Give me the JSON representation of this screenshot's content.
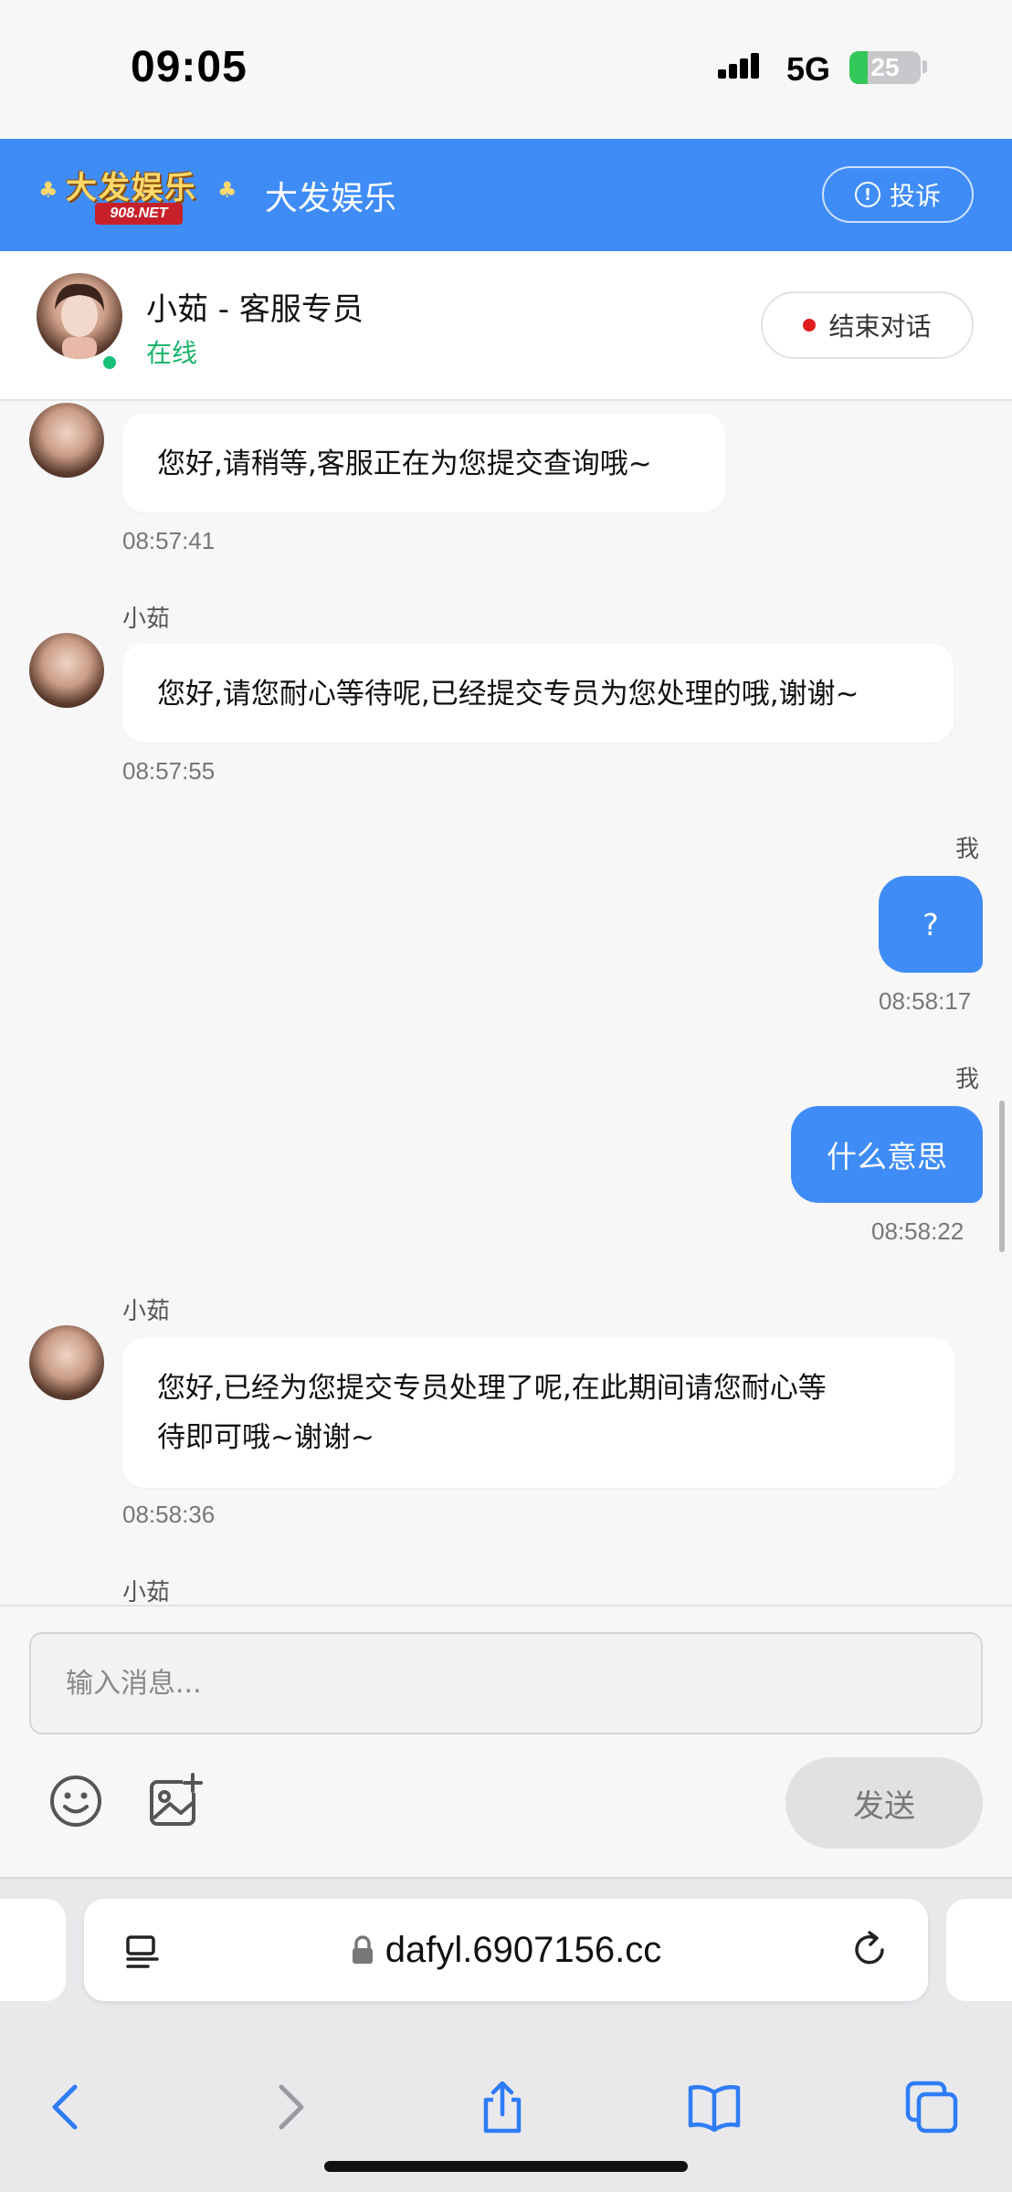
{
  "status_bar": {
    "time": "09:05",
    "network": "5G",
    "battery": "25",
    "battery_level": 0.25,
    "signal_icon": "cellular-signal-icon",
    "battery_icon": "battery-charging-icon"
  },
  "header": {
    "logo_text": "大发娱乐",
    "logo_sub": "908.NET",
    "title": "大发娱乐",
    "complain_label": "投诉",
    "complain_icon": "exclamation-circle-icon",
    "color": "#3f8cf7"
  },
  "agent": {
    "name": "小茹 - 客服专员",
    "status": "在线",
    "status_color": "#18b46c",
    "end_label": "结束对话",
    "end_dot_color": "#e01d1d"
  },
  "messages": [
    {
      "side": "in",
      "sender": "",
      "text": "您好,请稍等,客服正在为您提交查询哦~",
      "time": "08:57:41"
    },
    {
      "side": "in",
      "sender": "小茹",
      "text": "您好,请您耐心等待呢,已经提交专员为您处理的哦,谢谢~",
      "time": "08:57:55"
    },
    {
      "side": "out",
      "sender": "我",
      "text": "?",
      "time": "08:58:17"
    },
    {
      "side": "out",
      "sender": "我",
      "text": "什么意思",
      "time": "08:58:22"
    },
    {
      "side": "in",
      "sender": "小茹",
      "text_line1": "您好,已经为您提交专员处理了呢,在此期间请您耐心等",
      "text_line2": "待即可哦~谢谢~",
      "time": "08:58:36"
    },
    {
      "side": "in",
      "sender": "小茹"
    }
  ],
  "composer": {
    "placeholder": "输入消息...",
    "emoji_icon": "emoji-smile-icon",
    "image_icon": "image-add-icon",
    "send_label": "发送"
  },
  "browser": {
    "url": "dafyl.6907156.cc",
    "lock_icon": "lock-icon",
    "reader_icon": "reader-mode-icon",
    "reload_icon": "reload-icon",
    "nav_icons": [
      "back-icon",
      "forward-icon",
      "share-icon",
      "bookmarks-icon",
      "tabs-icon"
    ]
  }
}
